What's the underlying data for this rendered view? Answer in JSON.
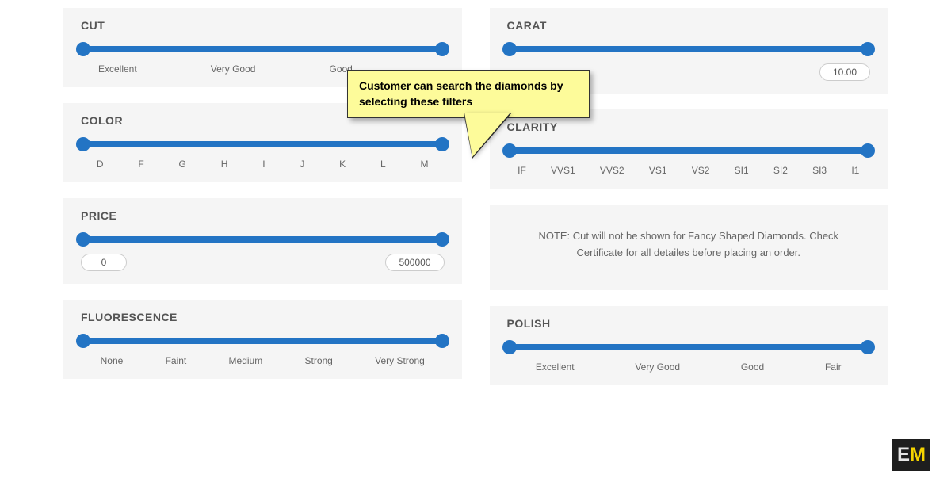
{
  "filters": {
    "cut": {
      "title": "CUT",
      "ticks": [
        "Excellent",
        "Very Good",
        "Good"
      ]
    },
    "carat": {
      "title": "CARAT",
      "maxValue": "10.00"
    },
    "color": {
      "title": "COLOR",
      "ticks": [
        "D",
        "F",
        "G",
        "H",
        "I",
        "J",
        "K",
        "L",
        "M"
      ]
    },
    "clarity": {
      "title": "CLARITY",
      "ticks": [
        "IF",
        "VVS1",
        "VVS2",
        "VS1",
        "VS2",
        "SI1",
        "SI2",
        "SI3",
        "I1"
      ]
    },
    "price": {
      "title": "PRICE",
      "minValue": "0",
      "maxValue": "500000"
    },
    "fluorescence": {
      "title": "FLUORESCENCE",
      "ticks": [
        "None",
        "Faint",
        "Medium",
        "Strong",
        "Very Strong"
      ]
    },
    "polish": {
      "title": "POLISH",
      "ticks": [
        "Excellent",
        "Very Good",
        "Good",
        "Fair"
      ]
    }
  },
  "note": "NOTE: Cut will not be shown for Fancy Shaped Diamonds. Check Certificate for all detailes before placing an order.",
  "callout": "Customer can search the diamonds by selecting these filters",
  "logo": {
    "e": "E",
    "m": "M"
  }
}
